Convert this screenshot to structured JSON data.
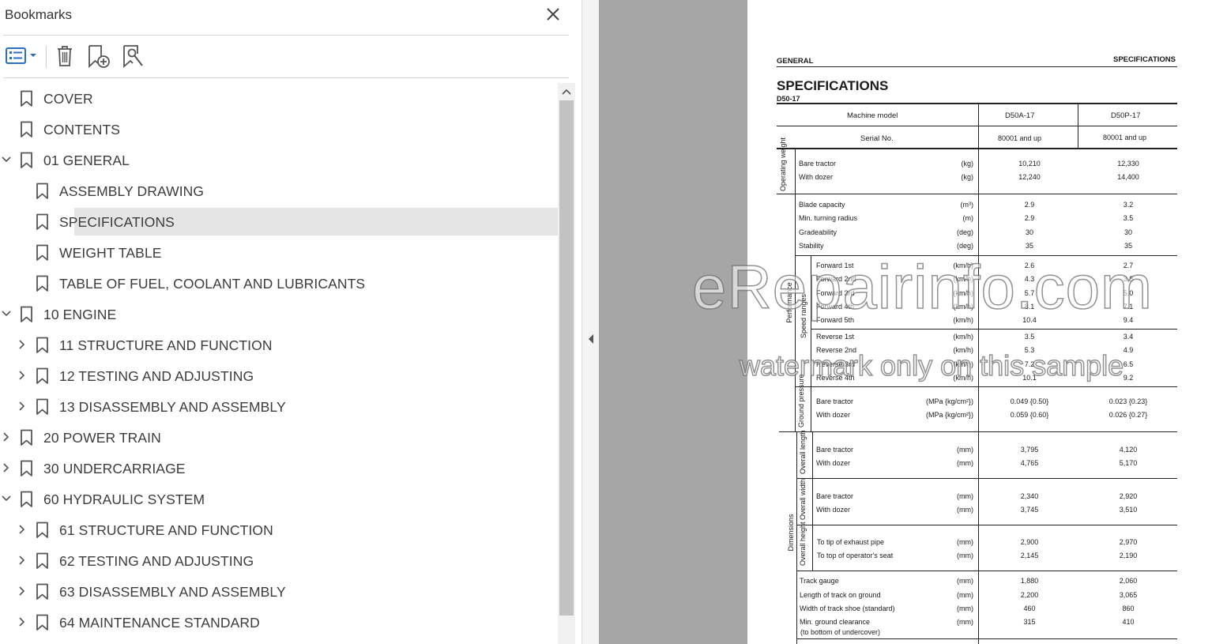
{
  "panel": {
    "title": "Bookmarks",
    "toolbar": {
      "options_icon": "list-options-icon",
      "delete_icon": "trash-icon",
      "new_bookmark_icon": "new-bookmark-icon",
      "find_bookmark_icon": "find-bookmark-icon"
    }
  },
  "bookmarks": [
    {
      "label": "COVER",
      "level": 0,
      "caret": "none"
    },
    {
      "label": "CONTENTS",
      "level": 0,
      "caret": "none"
    },
    {
      "label": "01 GENERAL",
      "level": 0,
      "caret": "down"
    },
    {
      "label": "ASSEMBLY DRAWING",
      "level": 1,
      "caret": "none"
    },
    {
      "label": "SPECIFICATIONS",
      "level": 1,
      "caret": "none",
      "selected": true
    },
    {
      "label": "WEIGHT TABLE",
      "level": 1,
      "caret": "none"
    },
    {
      "label": "TABLE OF FUEL, COOLANT AND LUBRICANTS",
      "level": 1,
      "caret": "none"
    },
    {
      "label": "10 ENGINE",
      "level": 0,
      "caret": "down"
    },
    {
      "label": "11 STRUCTURE AND FUNCTION",
      "level": 1,
      "caret": "right"
    },
    {
      "label": "12 TESTING AND ADJUSTING",
      "level": 1,
      "caret": "right"
    },
    {
      "label": "13 DISASSEMBLY AND ASSEMBLY",
      "level": 1,
      "caret": "right"
    },
    {
      "label": "20 POWER TRAIN",
      "level": 0,
      "caret": "right"
    },
    {
      "label": "30 UNDERCARRIAGE",
      "level": 0,
      "caret": "right"
    },
    {
      "label": "60 HYDRAULIC SYSTEM",
      "level": 0,
      "caret": "down"
    },
    {
      "label": "61 STRUCTURE AND FUNCTION",
      "level": 1,
      "caret": "right"
    },
    {
      "label": "62 TESTING AND ADJUSTING",
      "level": 1,
      "caret": "right"
    },
    {
      "label": "63 DISASSEMBLY AND ASSEMBLY",
      "level": 1,
      "caret": "right"
    },
    {
      "label": "64 MAINTENANCE STANDARD",
      "level": 1,
      "caret": "right"
    }
  ],
  "document": {
    "header_left": "GENERAL",
    "header_right": "SPECIFICATIONS",
    "title": "SPECIFICATIONS",
    "subtitle": "D50-17",
    "col_model_label": "Machine model",
    "col_serial_label": "Serial No.",
    "model_a": "D50A-17",
    "model_p": "D50P-17",
    "serial_a": "80001 and up",
    "serial_p": "80001 and up",
    "group_operating_weight": "Operating weight",
    "group_performance": "Performance",
    "group_speed_ranges": "Speed ranges",
    "group_ground_pressure": "Ground pressure",
    "group_dimensions": "Dimensions",
    "group_overall_length": "Overall length",
    "group_overall_width": "Overall width",
    "group_overall_height": "Overall height",
    "rows": [
      {
        "item": "Bare tractor",
        "unit": "(kg)",
        "a": "10,210",
        "p": "12,330"
      },
      {
        "item": "With dozer",
        "unit": "(kg)",
        "a": "12,240",
        "p": "14,400"
      },
      {
        "item": "Blade capacity",
        "unit": "(m³)",
        "a": "2.9",
        "p": "3.2"
      },
      {
        "item": "Min. turning radius",
        "unit": "(m)",
        "a": "2.9",
        "p": "3.5"
      },
      {
        "item": "Gradeability",
        "unit": "(deg)",
        "a": "30",
        "p": "30"
      },
      {
        "item": "Stability",
        "unit": "(deg)",
        "a": "35",
        "p": "35"
      },
      {
        "item": "Forward 1st",
        "unit": "(km/h)",
        "a": "2.6",
        "p": "2.7"
      },
      {
        "item": "Forward 2nd",
        "unit": "(km/h)",
        "a": "4.3",
        "p": "3.8"
      },
      {
        "item": "Forward 3rd",
        "unit": "(km/h)",
        "a": "5.7",
        "p": "5.0"
      },
      {
        "item": "Forward 4th",
        "unit": "(km/h)",
        "a": "8.1",
        "p": "7.1"
      },
      {
        "item": "Forward 5th",
        "unit": "(km/h)",
        "a": "10.4",
        "p": "9.4"
      },
      {
        "item": "Reverse 1st",
        "unit": "(km/h)",
        "a": "3.5",
        "p": "3.4"
      },
      {
        "item": "Reverse 2nd",
        "unit": "(km/h)",
        "a": "5.3",
        "p": "4.9"
      },
      {
        "item": "Reverse 3rd",
        "unit": "(km/h)",
        "a": "7.2",
        "p": "6.5"
      },
      {
        "item": "Reverse 4th",
        "unit": "(km/h)",
        "a": "10.1",
        "p": "9.2"
      },
      {
        "item": "Bare tractor",
        "unit": "(MPa {kg/cm²})",
        "a": "0.049 {0.50}",
        "p": "0.023 {0.23}"
      },
      {
        "item": "With dozer",
        "unit": "(MPa {kg/cm²})",
        "a": "0.059 {0.60}",
        "p": "0.026 {0.27}"
      },
      {
        "item": "Bare tractor",
        "unit": "(mm)",
        "a": "3,795",
        "p": "4,120"
      },
      {
        "item": "With dozer",
        "unit": "(mm)",
        "a": "4,765",
        "p": "5,170"
      },
      {
        "item": "Bare tractor",
        "unit": "(mm)",
        "a": "2,340",
        "p": "2,920"
      },
      {
        "item": "With dozer",
        "unit": "(mm)",
        "a": "3,745",
        "p": "3,510"
      },
      {
        "item": "To tip of exhaust pipe",
        "unit": "(mm)",
        "a": "2,900",
        "p": "2,970"
      },
      {
        "item": "To top of operator's seat",
        "unit": "(mm)",
        "a": "2,145",
        "p": "2,190"
      },
      {
        "item": "Track gauge",
        "unit": "(mm)",
        "a": "1,880",
        "p": "2,060"
      },
      {
        "item": "Length of track on ground",
        "unit": "(mm)",
        "a": "2,200",
        "p": "3,065"
      },
      {
        "item": "Width of track shoe (standard)",
        "unit": "(mm)",
        "a": "460",
        "p": "860"
      },
      {
        "item": "Min. ground clearance",
        "unit": "(mm)",
        "a": "315",
        "p": "410"
      }
    ],
    "clearance_note": "(to bottom of undercover)"
  },
  "watermark": {
    "line1": "eRepairinfo.com",
    "line2": "watermark only on this sample"
  }
}
